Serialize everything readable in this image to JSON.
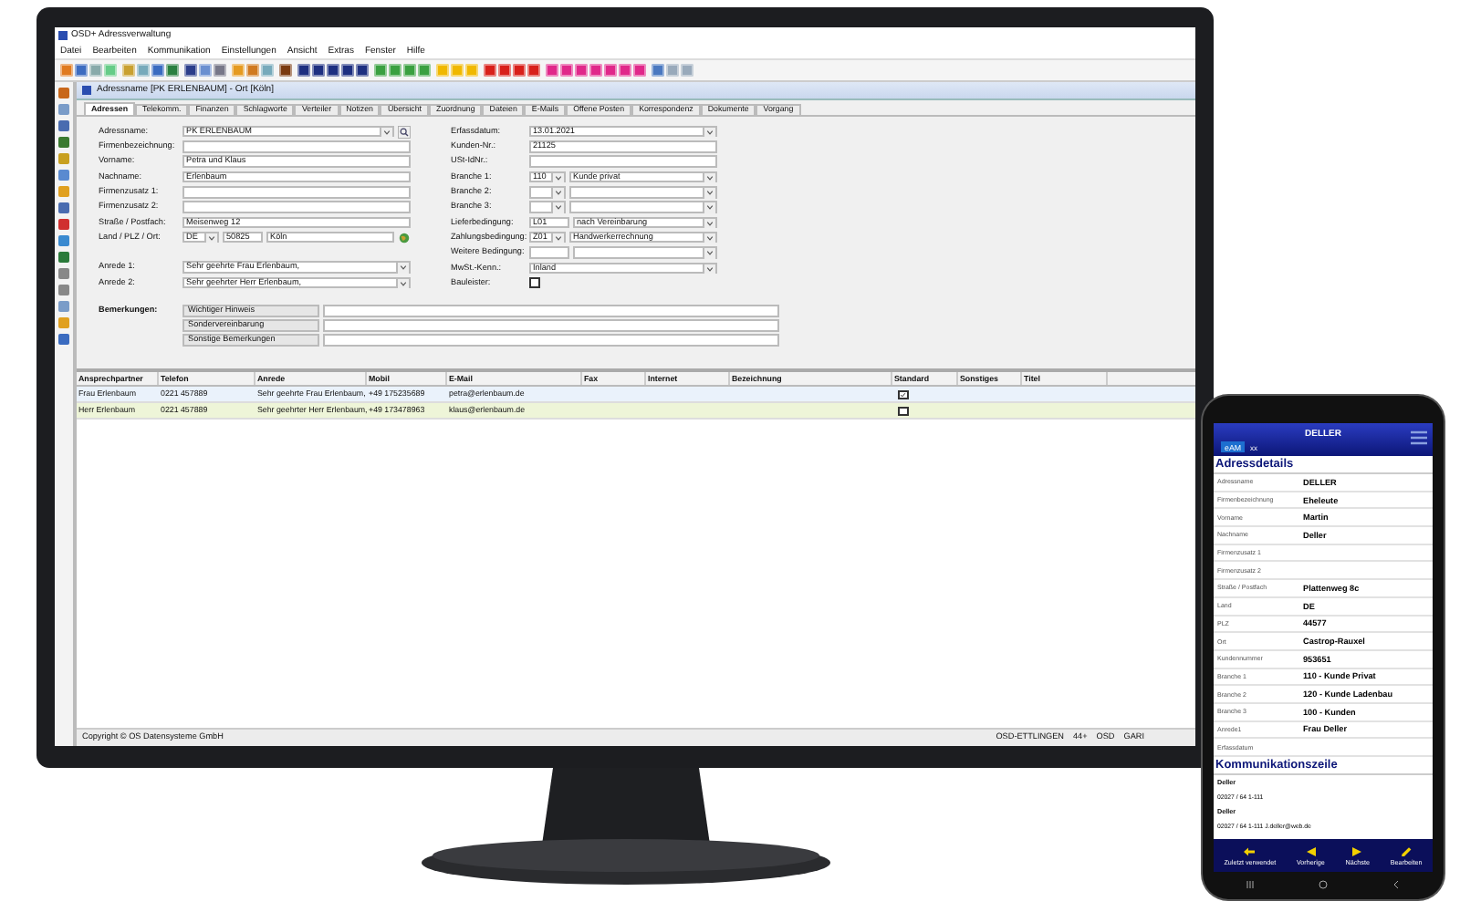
{
  "window": {
    "title": "OSD+ Adressverwaltung"
  },
  "menu": [
    "Datei",
    "Bearbeiten",
    "Kommunikation",
    "Einstellungen",
    "Ansicht",
    "Extras",
    "Fenster",
    "Hilfe"
  ],
  "inner_window": {
    "title": "Adressname [PK ERLENBAUM] - Ort [Köln]"
  },
  "tabs": [
    {
      "label": "Adressen",
      "selected": true
    },
    {
      "label": "Telekomm.",
      "selected": false
    },
    {
      "label": "Finanzen",
      "selected": false
    },
    {
      "label": "Schlagworte",
      "selected": false
    },
    {
      "label": "Verteiler",
      "selected": false
    },
    {
      "label": "Notizen",
      "selected": false
    },
    {
      "label": "Übersicht",
      "selected": false
    },
    {
      "label": "Zuordnung",
      "selected": false
    },
    {
      "label": "Dateien",
      "selected": false
    },
    {
      "label": "E-Mails",
      "selected": false
    },
    {
      "label": "Offene Posten",
      "selected": false
    },
    {
      "label": "Korrespondenz",
      "selected": false
    },
    {
      "label": "Dokumente",
      "selected": false
    },
    {
      "label": "Vorgang",
      "selected": false
    }
  ],
  "form": {
    "left_groups": [
      [
        {
          "label": "Adressname:",
          "parts": [
            {
              "kind": "combo",
              "value": "PK ERLENBAUM"
            },
            {
              "kind": "search-button"
            }
          ]
        },
        {
          "label": "Firmenbezeichnung:",
          "parts": [
            {
              "kind": "text"
            }
          ]
        },
        {
          "label": "Vorname:",
          "parts": [
            {
              "kind": "text",
              "value": "Petra und Klaus"
            }
          ]
        },
        {
          "label": "Nachname:",
          "parts": [
            {
              "kind": "text",
              "value": "Erlenbaum"
            }
          ]
        },
        {
          "label": "Firmenzusatz 1:",
          "parts": [
            {
              "kind": "text"
            }
          ]
        },
        {
          "label": "Firmenzusatz 2:",
          "parts": [
            {
              "kind": "text"
            }
          ]
        },
        {
          "label": "Straße / Postfach:",
          "parts": [
            {
              "kind": "text",
              "value": "Meisenweg 12"
            }
          ]
        },
        {
          "label": "Land / PLZ / Ort:",
          "parts": [
            {
              "kind": "code-combo",
              "value": "DE"
            },
            {
              "kind": "code",
              "value": "50825"
            },
            {
              "kind": "text",
              "value": "Köln"
            },
            {
              "kind": "globe-button"
            }
          ]
        }
      ],
      [
        {
          "label": "Anrede 1:",
          "parts": [
            {
              "kind": "combo",
              "value": "Sehr geehrte Frau Erlenbaum,"
            }
          ]
        },
        {
          "label": "Anrede 2:",
          "parts": [
            {
              "kind": "combo",
              "value": "Sehr geehrter Herr Erlenbaum,"
            }
          ]
        }
      ]
    ],
    "right": [
      {
        "label": "Erfassdatum:",
        "parts": [
          {
            "kind": "combo",
            "value": "13.01.2021"
          }
        ]
      },
      {
        "label": "Kunden-Nr.:",
        "parts": [
          {
            "kind": "text",
            "value": "21125"
          }
        ]
      },
      {
        "label": "USt-IdNr.:",
        "parts": [
          {
            "kind": "text"
          }
        ]
      },
      {
        "label": "Branche 1:",
        "parts": [
          {
            "kind": "code-combo",
            "value": "110"
          },
          {
            "kind": "combo",
            "value": "Kunde privat"
          }
        ]
      },
      {
        "label": "Branche 2:",
        "parts": [
          {
            "kind": "code-combo"
          },
          {
            "kind": "combo"
          }
        ]
      },
      {
        "label": "Branche 3:",
        "parts": [
          {
            "kind": "code-combo"
          },
          {
            "kind": "combo"
          }
        ]
      },
      {
        "label": "Lieferbedingung:",
        "parts": [
          {
            "kind": "code",
            "value": "L01"
          },
          {
            "kind": "combo",
            "value": "nach Vereinbarung"
          }
        ]
      },
      {
        "label": "Zahlungsbedingung:",
        "parts": [
          {
            "kind": "code-combo",
            "value": "Z01"
          },
          {
            "kind": "combo",
            "value": "Handwerkerrechnung"
          }
        ]
      },
      {
        "label": "Weitere Bedingung:",
        "parts": [
          {
            "kind": "code"
          },
          {
            "kind": "combo"
          }
        ]
      },
      {
        "label": "MwSt.-Kenn.:",
        "parts": [
          {
            "kind": "combo",
            "value": "Inland"
          }
        ]
      },
      {
        "label": "Bauleister:",
        "parts": [
          {
            "kind": "checkbox",
            "checked": false
          }
        ]
      }
    ]
  },
  "remarks": {
    "label": "Bemerkungen:",
    "items": [
      "Wichtiger Hinweis",
      "Sondervereinbarung",
      "Sonstige Bemerkungen"
    ]
  },
  "table": {
    "columns": [
      "Ansprechpartner",
      "Telefon",
      "Anrede",
      "Mobil",
      "E-Mail",
      "Fax",
      "Internet",
      "Bezeichnung",
      "Standard",
      "Sonstiges",
      "Titel"
    ],
    "rows": [
      {
        "cells": [
          "Frau Erlenbaum",
          "0221 457889",
          "Sehr geehrte Frau Erlenbaum,",
          "+49 175235689",
          "petra@erlenbaum.de"
        ],
        "standard": true,
        "selected": false
      },
      {
        "cells": [
          "Herr Erlenbaum",
          "0221 457889",
          "Sehr geehrter Herr Erlenbaum,",
          "+49 173478963",
          "klaus@erlenbaum.de"
        ],
        "standard": false,
        "selected": true
      }
    ]
  },
  "status_bar": {
    "left": "Copyright © OS Datensysteme GmbH",
    "right": [
      "OSD-ETTLINGEN",
      "44+",
      "OSD",
      "GARI"
    ]
  },
  "phone": {
    "header": {
      "title": "DELLER",
      "badge": "eAM",
      "subtitle": "xx"
    },
    "section_title": "Adressdetails",
    "rows": [
      {
        "label": "Adressname",
        "value": "DELLER"
      },
      {
        "label": "Firmenbezeichnung",
        "value": "Eheleute"
      },
      {
        "label": "Vorname",
        "value": "Martin"
      },
      {
        "label": "Nachname",
        "value": "Deller"
      },
      {
        "label": "Firmenzusatz 1"
      },
      {
        "label": "Firmenzusatz 2"
      },
      {
        "label": "Straße / Postfach",
        "value": "Plattenweg 8c"
      },
      {
        "label": "Land",
        "value": "DE"
      },
      {
        "label": "PLZ",
        "value": "44577"
      },
      {
        "label": "Ort",
        "value": "Castrop-Rauxel"
      },
      {
        "label": "Kundennummer",
        "value": "953651"
      },
      {
        "label": "Branche 1",
        "value": "110 - Kunde Privat"
      },
      {
        "label": "Branche 2",
        "value": "120 - Kunde Ladenbau"
      },
      {
        "label": "Branche 3",
        "value": "100 - Kunden"
      },
      {
        "label": "Anrede1",
        "value": "Frau Deller"
      },
      {
        "label": "Erfassdatum"
      }
    ],
    "comm_title": "Kommunikationszeile",
    "comm": [
      {
        "name": "Deller",
        "detail": "02027 / 64 1-111"
      },
      {
        "name": "Deller",
        "detail": "02027 / 64 1-111 J.deller@web.de"
      }
    ],
    "nav": [
      {
        "kind": "back",
        "label": "Zuletzt verwendet"
      },
      {
        "kind": "prev",
        "label": "Vorherige"
      },
      {
        "kind": "next",
        "label": "Nächste"
      },
      {
        "kind": "edit",
        "label": "Bearbeiten"
      }
    ]
  }
}
